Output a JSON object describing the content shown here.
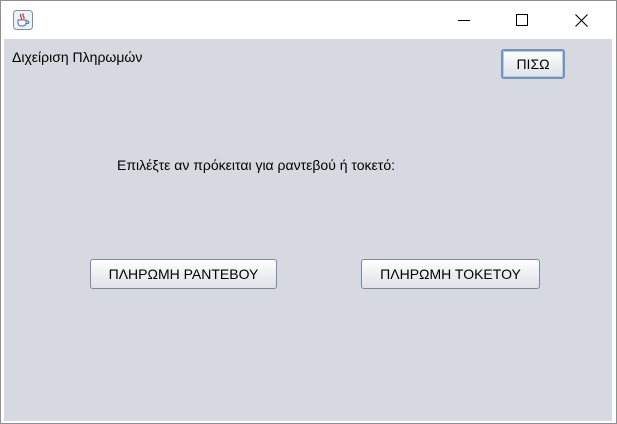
{
  "window": {
    "icon": "java-cup-icon",
    "controls": {
      "minimize": "minimize-icon",
      "maximize": "maximize-icon",
      "close": "close-icon"
    }
  },
  "panel": {
    "title": "Διχείριση Πληρωμών",
    "back_label": "ΠΙΣΩ",
    "prompt": "Επιλέξτε αν πρόκειται για ραντεβού ή τοκετό:",
    "appointment_payment_label": "ΠΛΗΡΩΜΗ ΡΑΝΤΕΒΟΥ",
    "birth_payment_label": "ΠΛΗΡΩΜΗ ΤΟΚΕΤΟΥ"
  },
  "colors": {
    "panel_background": "#d6d9df",
    "focus_border": "#6f94c2"
  }
}
